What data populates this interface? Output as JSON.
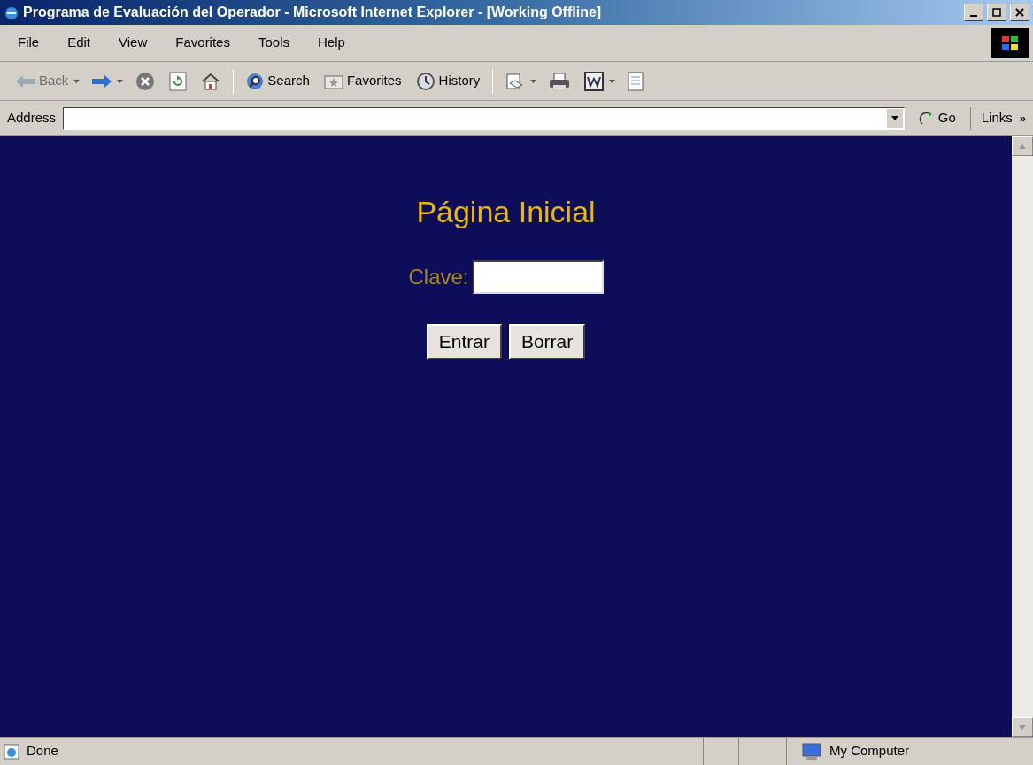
{
  "window": {
    "title": "Programa de Evaluación del Operador - Microsoft Internet Explorer - [Working Offline]"
  },
  "menu": [
    "File",
    "Edit",
    "View",
    "Favorites",
    "Tools",
    "Help"
  ],
  "toolbar": [
    {
      "kind": "back",
      "label": "Back",
      "disabled": true
    },
    {
      "kind": "forward"
    },
    {
      "kind": "stop"
    },
    {
      "kind": "refresh"
    },
    {
      "kind": "home"
    },
    {
      "kind": "sep"
    },
    {
      "kind": "search",
      "label": "Search"
    },
    {
      "kind": "favorites",
      "label": "Favorites"
    },
    {
      "kind": "history",
      "label": "History"
    },
    {
      "kind": "sep"
    },
    {
      "kind": "mail"
    },
    {
      "kind": "print"
    },
    {
      "kind": "word"
    },
    {
      "kind": "note"
    }
  ],
  "address": {
    "label": "Address",
    "go": "Go",
    "links": "Links",
    "links_more": "»"
  },
  "page": {
    "heading": "Página Inicial",
    "field_label": "Clave:",
    "buttons": [
      "Entrar",
      "Borrar"
    ]
  },
  "status_bar": {
    "text": "Done",
    "zone": "My Computer"
  }
}
